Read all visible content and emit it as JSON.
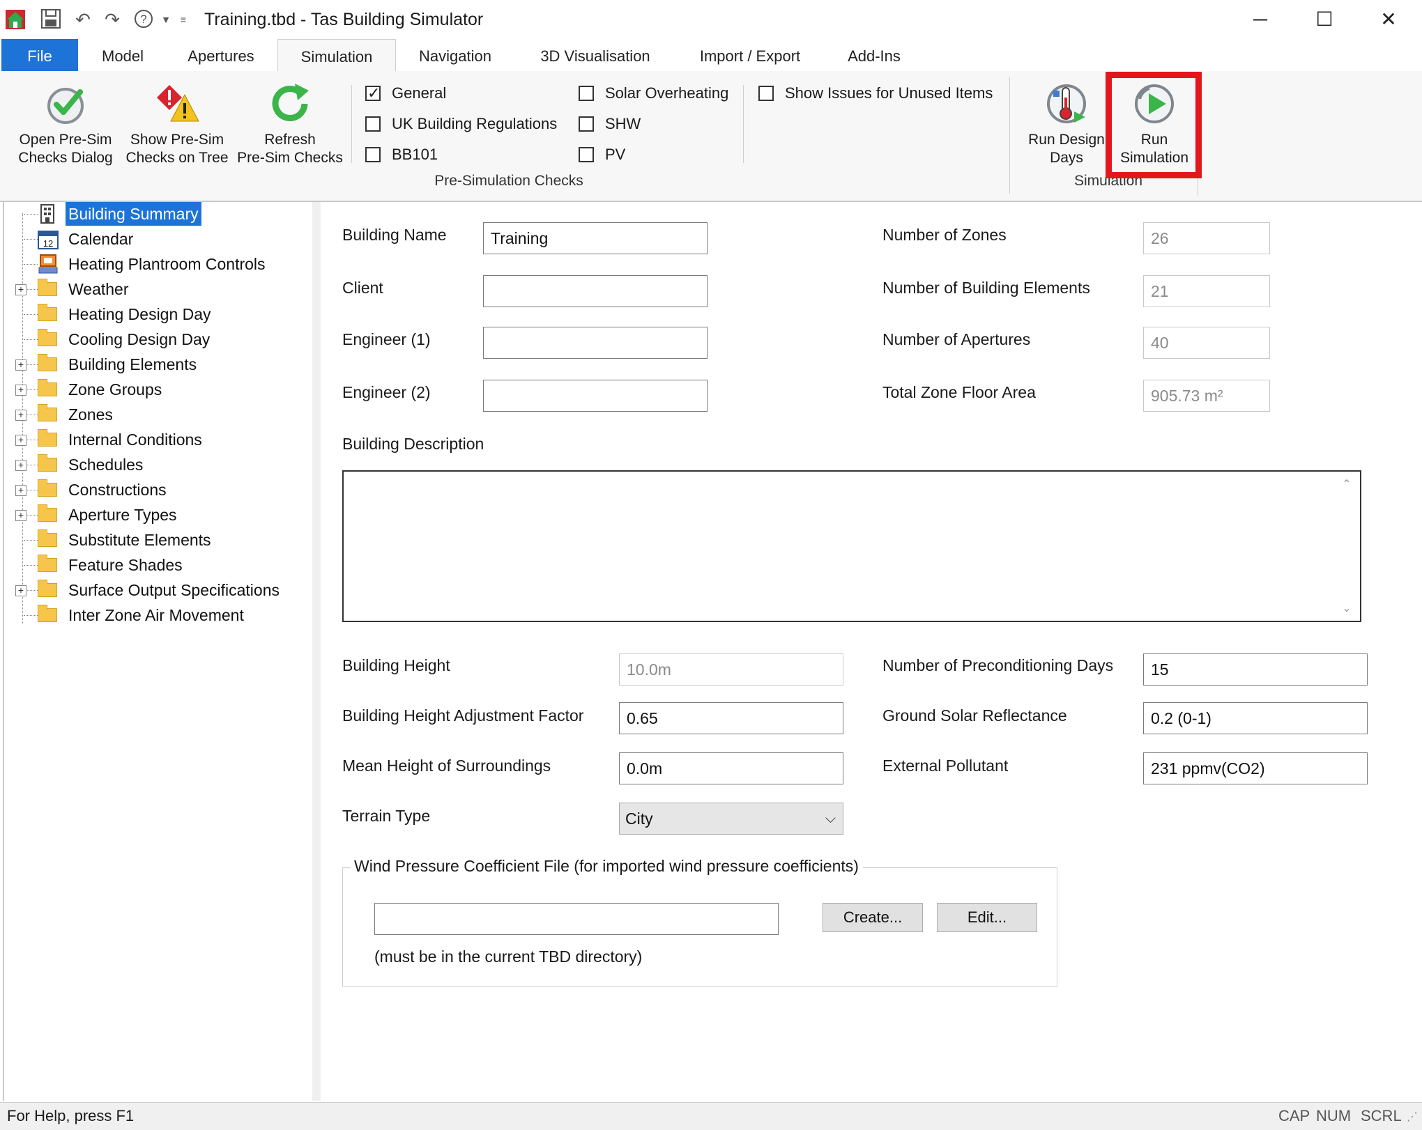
{
  "window": {
    "title": "Training.tbd - Tas Building Simulator",
    "controls": {
      "minimize": "─",
      "maximize": "☐",
      "close": "✕"
    }
  },
  "quick_access": {
    "app_icon": "house-icon",
    "icons": [
      "save-icon",
      "undo-icon",
      "redo-icon",
      "help-icon",
      "dropdown-icon",
      "customize-icon"
    ]
  },
  "tabs": [
    {
      "label": "File"
    },
    {
      "label": "Model"
    },
    {
      "label": "Apertures"
    },
    {
      "label": "Simulation"
    },
    {
      "label": "Navigation"
    },
    {
      "label": "3D Visualisation"
    },
    {
      "label": "Import / Export"
    },
    {
      "label": "Add-Ins"
    }
  ],
  "ribbon": {
    "buttons": {
      "open_presim": "Open Pre-Sim\nChecks Dialog",
      "show_presim": "Show Pre-Sim\nChecks on Tree",
      "refresh_presim": "Refresh\nPre-Sim Checks",
      "run_design_days": "Run Design\nDays",
      "run_simulation": "Run\nSimulation"
    },
    "checks": {
      "general": {
        "label": "General",
        "checked": true
      },
      "uk_regs": {
        "label": "UK Building Regulations",
        "checked": false
      },
      "bb101": {
        "label": "BB101",
        "checked": false
      },
      "solar": {
        "label": "Solar Overheating",
        "checked": false
      },
      "shw": {
        "label": "SHW",
        "checked": false
      },
      "pv": {
        "label": "PV",
        "checked": false
      },
      "unused": {
        "label": "Show Issues for Unused Items",
        "checked": false
      }
    },
    "group_presim": "Pre-Simulation Checks",
    "group_sim": "Simulation"
  },
  "tree": {
    "items": [
      {
        "label": "Building Summary",
        "icon": "building-icon",
        "expandable": false,
        "selected": true
      },
      {
        "label": "Calendar",
        "icon": "calendar-icon",
        "expandable": false
      },
      {
        "label": "Heating Plantroom Controls",
        "icon": "plantroom-icon",
        "expandable": false
      },
      {
        "label": "Weather",
        "icon": "folder-icon",
        "expandable": true
      },
      {
        "label": "Heating Design Day",
        "icon": "folder-icon",
        "expandable": false
      },
      {
        "label": "Cooling Design Day",
        "icon": "folder-icon",
        "expandable": false
      },
      {
        "label": "Building Elements",
        "icon": "folder-icon",
        "expandable": true
      },
      {
        "label": "Zone Groups",
        "icon": "folder-icon",
        "expandable": true
      },
      {
        "label": "Zones",
        "icon": "folder-icon",
        "expandable": true
      },
      {
        "label": "Internal Conditions",
        "icon": "folder-icon",
        "expandable": true
      },
      {
        "label": "Schedules",
        "icon": "folder-icon",
        "expandable": true
      },
      {
        "label": "Constructions",
        "icon": "folder-icon",
        "expandable": true
      },
      {
        "label": "Aperture Types",
        "icon": "folder-icon",
        "expandable": true
      },
      {
        "label": "Substitute Elements",
        "icon": "folder-icon",
        "expandable": false
      },
      {
        "label": "Feature Shades",
        "icon": "folder-icon",
        "expandable": false
      },
      {
        "label": "Surface Output Specifications",
        "icon": "folder-icon",
        "expandable": true
      },
      {
        "label": "Inter Zone Air Movement",
        "icon": "folder-icon",
        "expandable": false
      }
    ]
  },
  "form": {
    "building_name": {
      "label": "Building Name",
      "value": "Training"
    },
    "client": {
      "label": "Client",
      "value": ""
    },
    "engineer1": {
      "label": "Engineer (1)",
      "value": ""
    },
    "engineer2": {
      "label": "Engineer (2)",
      "value": ""
    },
    "num_zones": {
      "label": "Number of Zones",
      "value": "26"
    },
    "num_elements": {
      "label": "Number of Building Elements",
      "value": "21"
    },
    "num_apertures": {
      "label": "Number of Apertures",
      "value": "40"
    },
    "floor_area": {
      "label": "Total Zone Floor Area",
      "value": "905.73 m²"
    },
    "description": {
      "label": "Building Description",
      "value": ""
    },
    "height": {
      "label": "Building Height",
      "value": "10.0m"
    },
    "height_factor": {
      "label": "Building Height Adjustment Factor",
      "value": "0.65"
    },
    "surroundings": {
      "label": "Mean Height of Surroundings",
      "value": "0.0m"
    },
    "terrain": {
      "label": "Terrain Type",
      "value": "City"
    },
    "precond_days": {
      "label": "Number of Preconditioning Days",
      "value": "15"
    },
    "ground_reflect": {
      "label": "Ground Solar Reflectance",
      "value": "0.2 (0-1)"
    },
    "pollutant": {
      "label": "External Pollutant",
      "value": "231 ppmv(CO2)"
    },
    "wind": {
      "title": "Wind Pressure Coefficient File (for imported wind pressure coefficients)",
      "value": "",
      "create": "Create...",
      "edit": "Edit...",
      "note": "(must be in the current TBD directory)"
    }
  },
  "status": {
    "text": "For Help, press F1",
    "cap": "CAP",
    "num": "NUM",
    "scrl": "SCRL"
  },
  "colors": {
    "accent": "#1e73d8",
    "highlight": "#e3161e"
  }
}
